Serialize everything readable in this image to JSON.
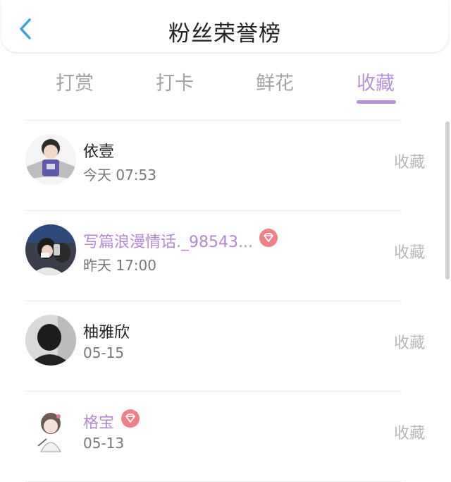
{
  "header": {
    "title": "粉丝荣誉榜"
  },
  "tabs": [
    {
      "label": "打赏",
      "active": false
    },
    {
      "label": "打卡",
      "active": false
    },
    {
      "label": "鲜花",
      "active": false
    },
    {
      "label": "收藏",
      "active": true
    }
  ],
  "fans": [
    {
      "name": "依壹",
      "time": "今天 07:53",
      "action": "收藏",
      "vip": false
    },
    {
      "name": "写篇浪漫情话._98543...",
      "time": "昨天 17:00",
      "action": "收藏",
      "vip": true
    },
    {
      "name": "柚雅欣",
      "time": "05-15",
      "action": "收藏",
      "vip": false
    },
    {
      "name": "格宝",
      "time": "05-13",
      "action": "收藏",
      "vip": true
    }
  ],
  "colors": {
    "accent": "#b593d6",
    "vip_badge": "#f07f88"
  },
  "icons": {
    "back": "chevron-left-icon",
    "vip": "diamond-icon"
  }
}
